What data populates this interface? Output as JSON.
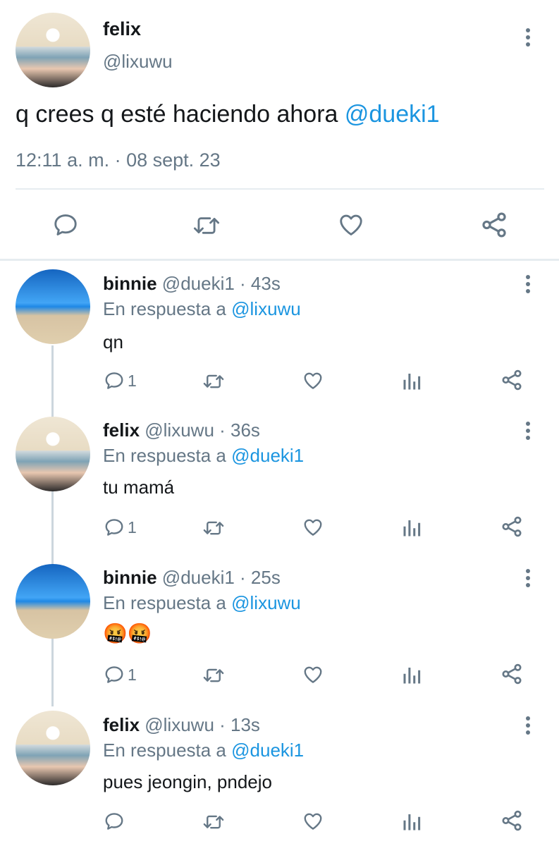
{
  "main_tweet": {
    "name": "felix",
    "handle": "@lixuwu",
    "text": "q crees q esté haciendo ahora ",
    "mention": "@dueki1",
    "timestamp": "12:11 a. m. · 08 sept. 23"
  },
  "replies": [
    {
      "name": "binnie",
      "meta": "@dueki1 · 43s",
      "reply_prefix": "En respuesta a ",
      "reply_to": "@lixuwu",
      "text": "qn",
      "reply_count": "1"
    },
    {
      "name": "felix",
      "meta": "@lixuwu · 36s",
      "reply_prefix": "En respuesta a ",
      "reply_to": "@dueki1",
      "text": "tu mamá",
      "reply_count": "1"
    },
    {
      "name": "binnie",
      "meta": "@dueki1 · 25s",
      "reply_prefix": "En respuesta a ",
      "reply_to": "@lixuwu",
      "text": "🤬🤬",
      "reply_count": "1"
    },
    {
      "name": "felix",
      "meta": "@lixuwu · 13s",
      "reply_prefix": "En respuesta a ",
      "reply_to": "@dueki1",
      "text": "pues jeongin, pndejo",
      "reply_count": ""
    }
  ],
  "icons": {
    "reply": "reply-icon",
    "retweet": "retweet-icon",
    "like": "heart-icon",
    "analytics": "analytics-icon",
    "share": "share-icon",
    "menu": "more-vertical-icon"
  },
  "colors": {
    "text": "#14171a",
    "secondary": "#657786",
    "link": "#1b95e0",
    "divider": "#e6ecf0"
  }
}
